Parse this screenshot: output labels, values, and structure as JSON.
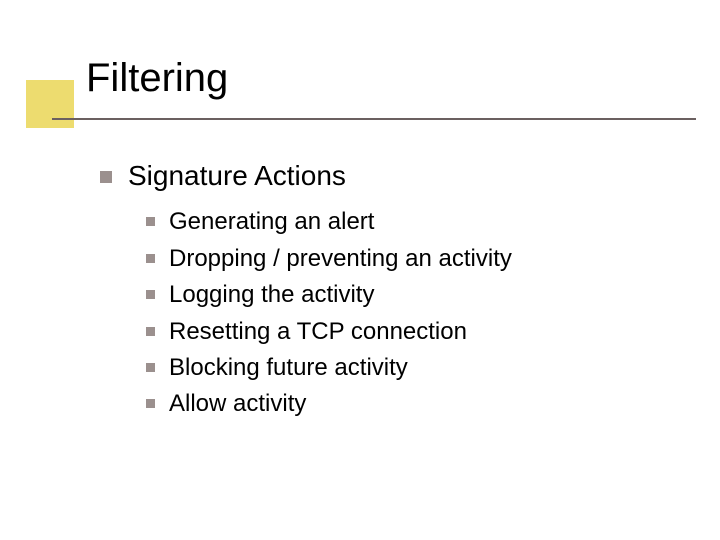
{
  "slide": {
    "title": "Filtering",
    "level1": {
      "text": "Signature Actions"
    },
    "level2": [
      {
        "text": "Generating an alert"
      },
      {
        "text": "Dropping / preventing an activity"
      },
      {
        "text": "Logging the activity"
      },
      {
        "text": "Resetting a TCP connection"
      },
      {
        "text": "Blocking future activity"
      },
      {
        "text": "Allow activity"
      }
    ]
  }
}
